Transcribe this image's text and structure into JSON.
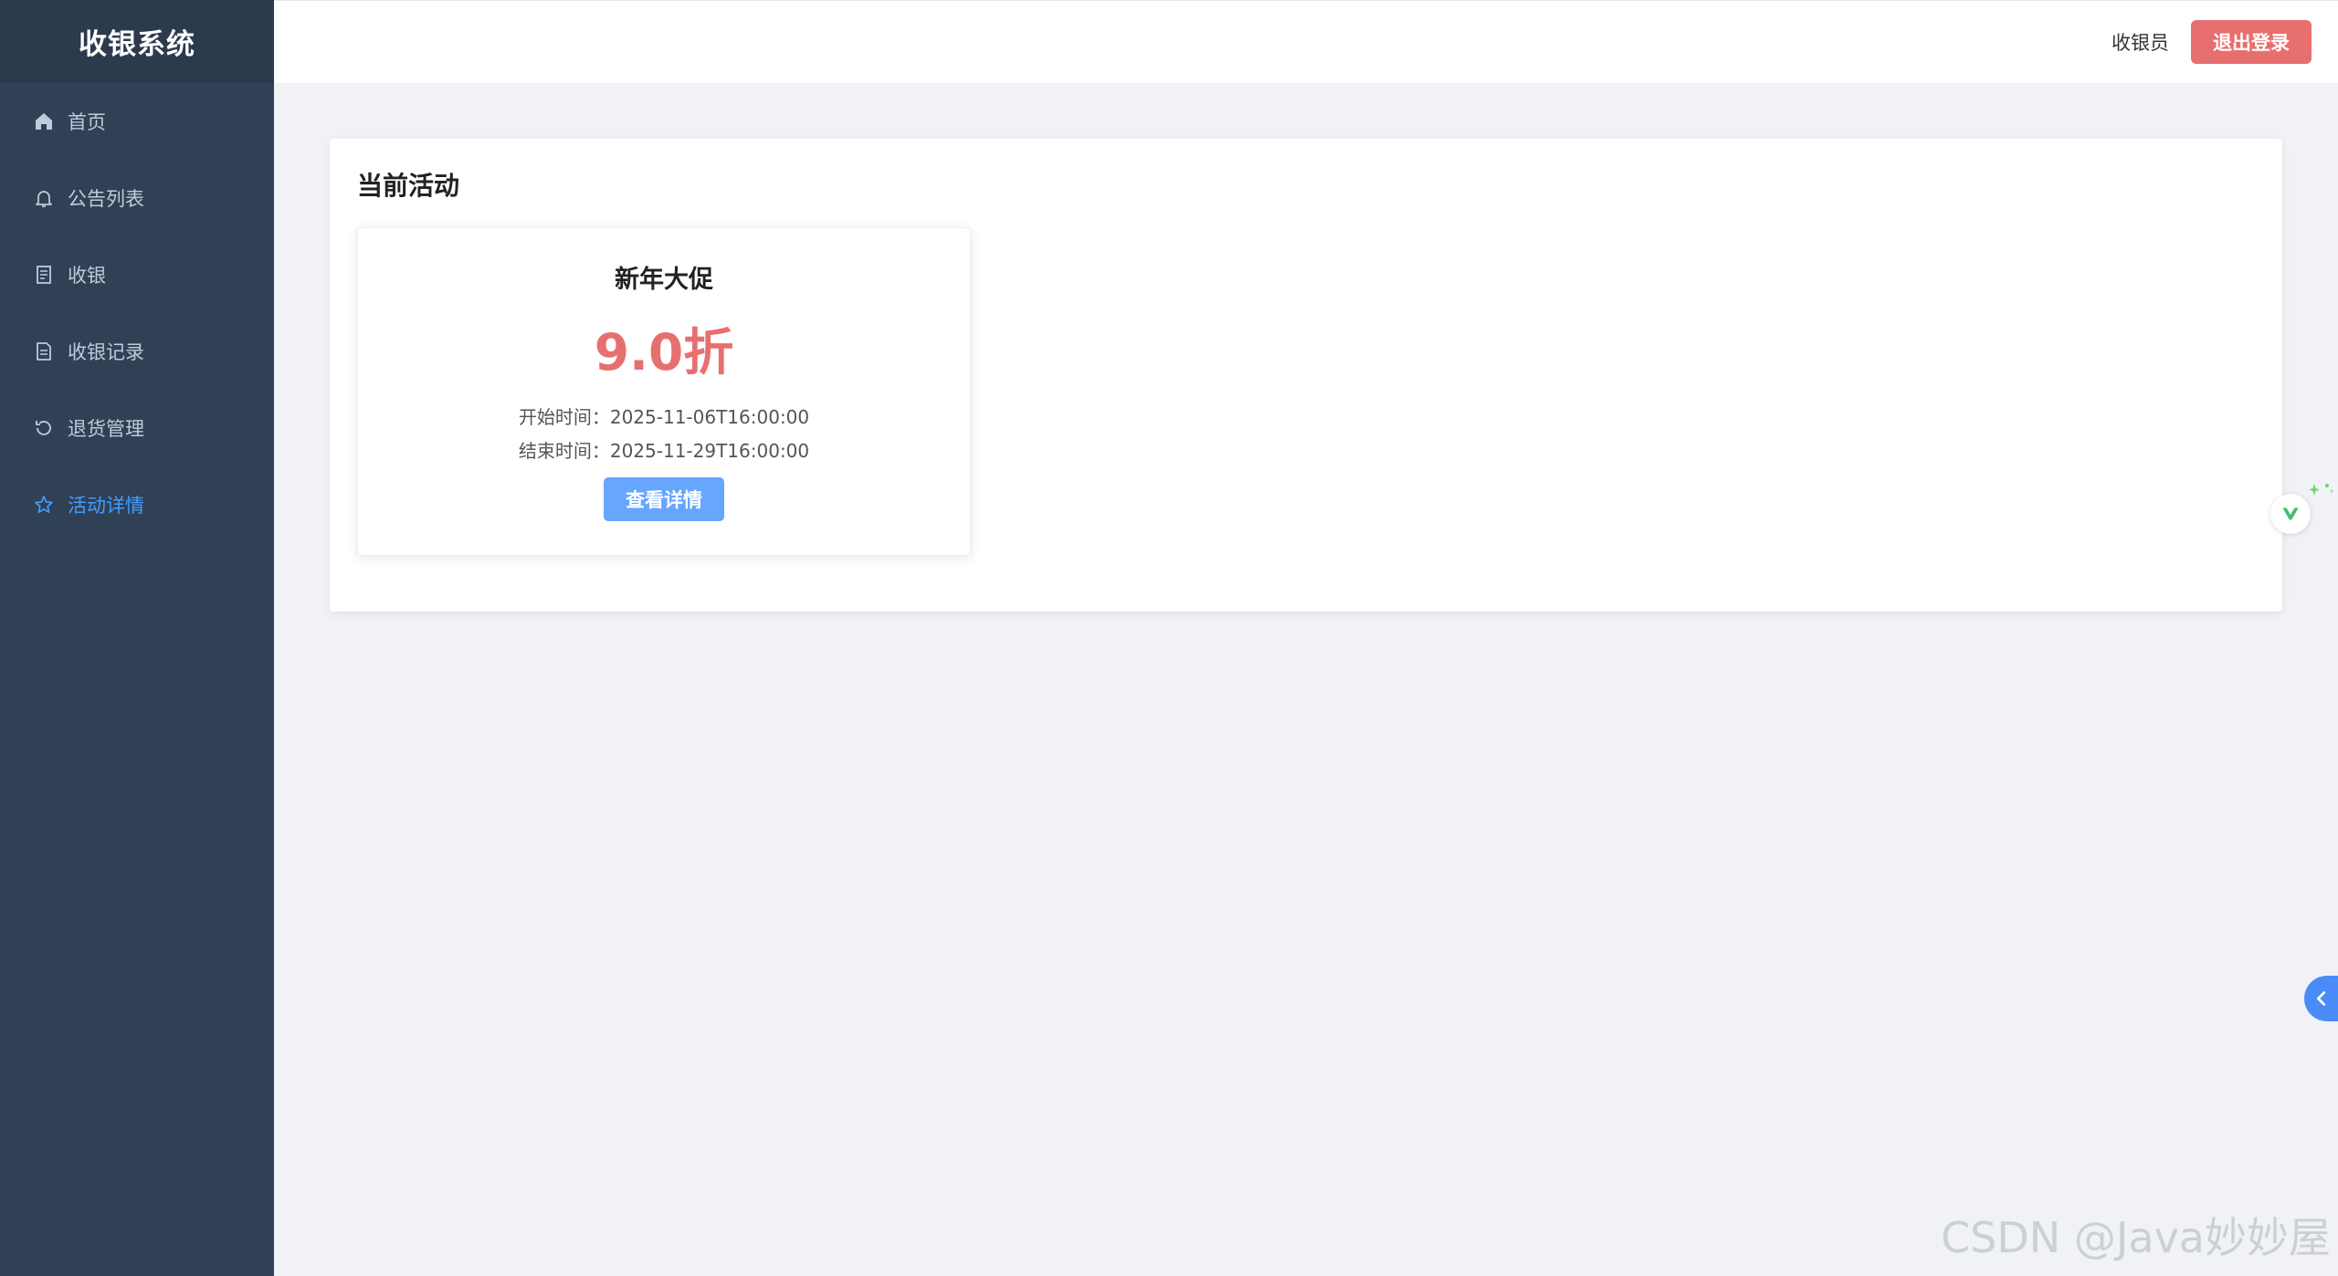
{
  "app": {
    "title": "收银系统"
  },
  "sidebar": {
    "items": [
      {
        "label": "首页",
        "icon": "home-icon"
      },
      {
        "label": "公告列表",
        "icon": "bell-icon"
      },
      {
        "label": "收银",
        "icon": "document-icon"
      },
      {
        "label": "收银记录",
        "icon": "document-icon"
      },
      {
        "label": "退货管理",
        "icon": "refresh-icon"
      },
      {
        "label": "活动详情",
        "icon": "star-icon",
        "active": true
      }
    ]
  },
  "header": {
    "user": "收银员",
    "logout_label": "退出登录"
  },
  "main": {
    "section_title": "当前活动",
    "activity": {
      "name": "新年大促",
      "discount": "9.0折",
      "start_label": "开始时间：",
      "start_time": "2025-11-06T16:00:00",
      "end_label": "结束时间：",
      "end_time": "2025-11-29T16:00:00",
      "detail_button": "查看详情"
    }
  },
  "watermark": "CSDN @Java妙妙屋",
  "colors": {
    "sidebar_bg": "#304156",
    "accent": "#409eff",
    "danger": "#e86f6f",
    "button_blue": "#66a6ff"
  }
}
